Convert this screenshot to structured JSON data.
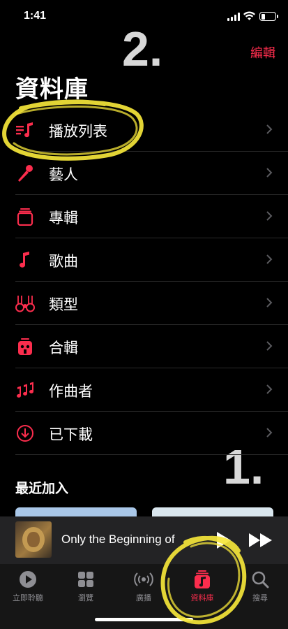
{
  "status_bar": {
    "time": "1:41",
    "battery_level": 0.25
  },
  "annotations": {
    "step_2": "2.",
    "step_1": "1."
  },
  "header": {
    "edit_label": "編輯",
    "title": "資料庫"
  },
  "library": {
    "items": [
      {
        "label": "播放列表",
        "icon": "playlist-icon"
      },
      {
        "label": "藝人",
        "icon": "microphone-icon"
      },
      {
        "label": "專輯",
        "icon": "album-stack-icon"
      },
      {
        "label": "歌曲",
        "icon": "music-note-icon"
      },
      {
        "label": "類型",
        "icon": "guitars-icon"
      },
      {
        "label": "合輯",
        "icon": "compilation-icon"
      },
      {
        "label": "作曲者",
        "icon": "composer-notes-icon"
      },
      {
        "label": "已下載",
        "icon": "download-circle-icon"
      }
    ]
  },
  "recent": {
    "title": "最近加入"
  },
  "mini_player": {
    "title": "Only the Beginning of",
    "play_icon": "play-icon",
    "forward_icon": "fast-forward-icon"
  },
  "tab_bar": {
    "tabs": [
      {
        "label": "立即聆聽",
        "icon": "listen-now-icon",
        "active": false
      },
      {
        "label": "瀏覽",
        "icon": "browse-grid-icon",
        "active": false
      },
      {
        "label": "廣播",
        "icon": "radio-icon",
        "active": false
      },
      {
        "label": "資料庫",
        "icon": "library-icon",
        "active": true
      },
      {
        "label": "搜尋",
        "icon": "search-icon",
        "active": false
      }
    ]
  },
  "colors": {
    "accent": "#fb2d4d",
    "annotation": "#f5e63a",
    "background": "#000000"
  }
}
